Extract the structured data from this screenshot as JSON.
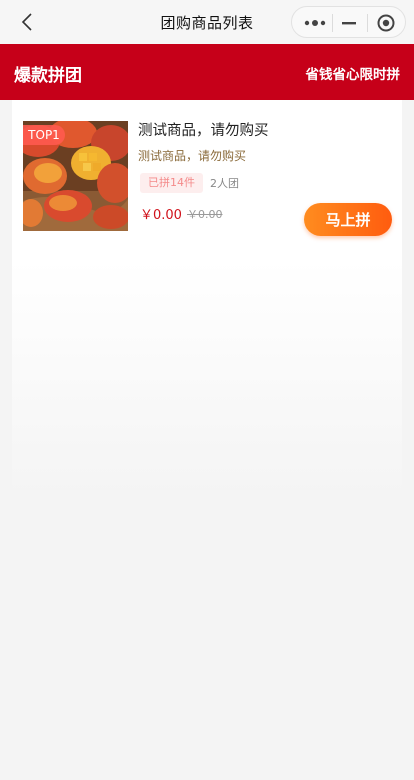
{
  "nav": {
    "title": "团购商品列表"
  },
  "banner": {
    "title": "爆款拼团",
    "slogan": "省钱省心限时拼",
    "color": "#c60019"
  },
  "products": [
    {
      "rank_badge": "TOP1",
      "title": "测试商品，请勿购买",
      "description": "测试商品，请勿购买",
      "sold_label": "已拼14件",
      "group_size": "2人团",
      "price": "￥0.00",
      "original_price": "￥0.00",
      "button_label": "马上拼",
      "image": "mango-photo"
    }
  ]
}
